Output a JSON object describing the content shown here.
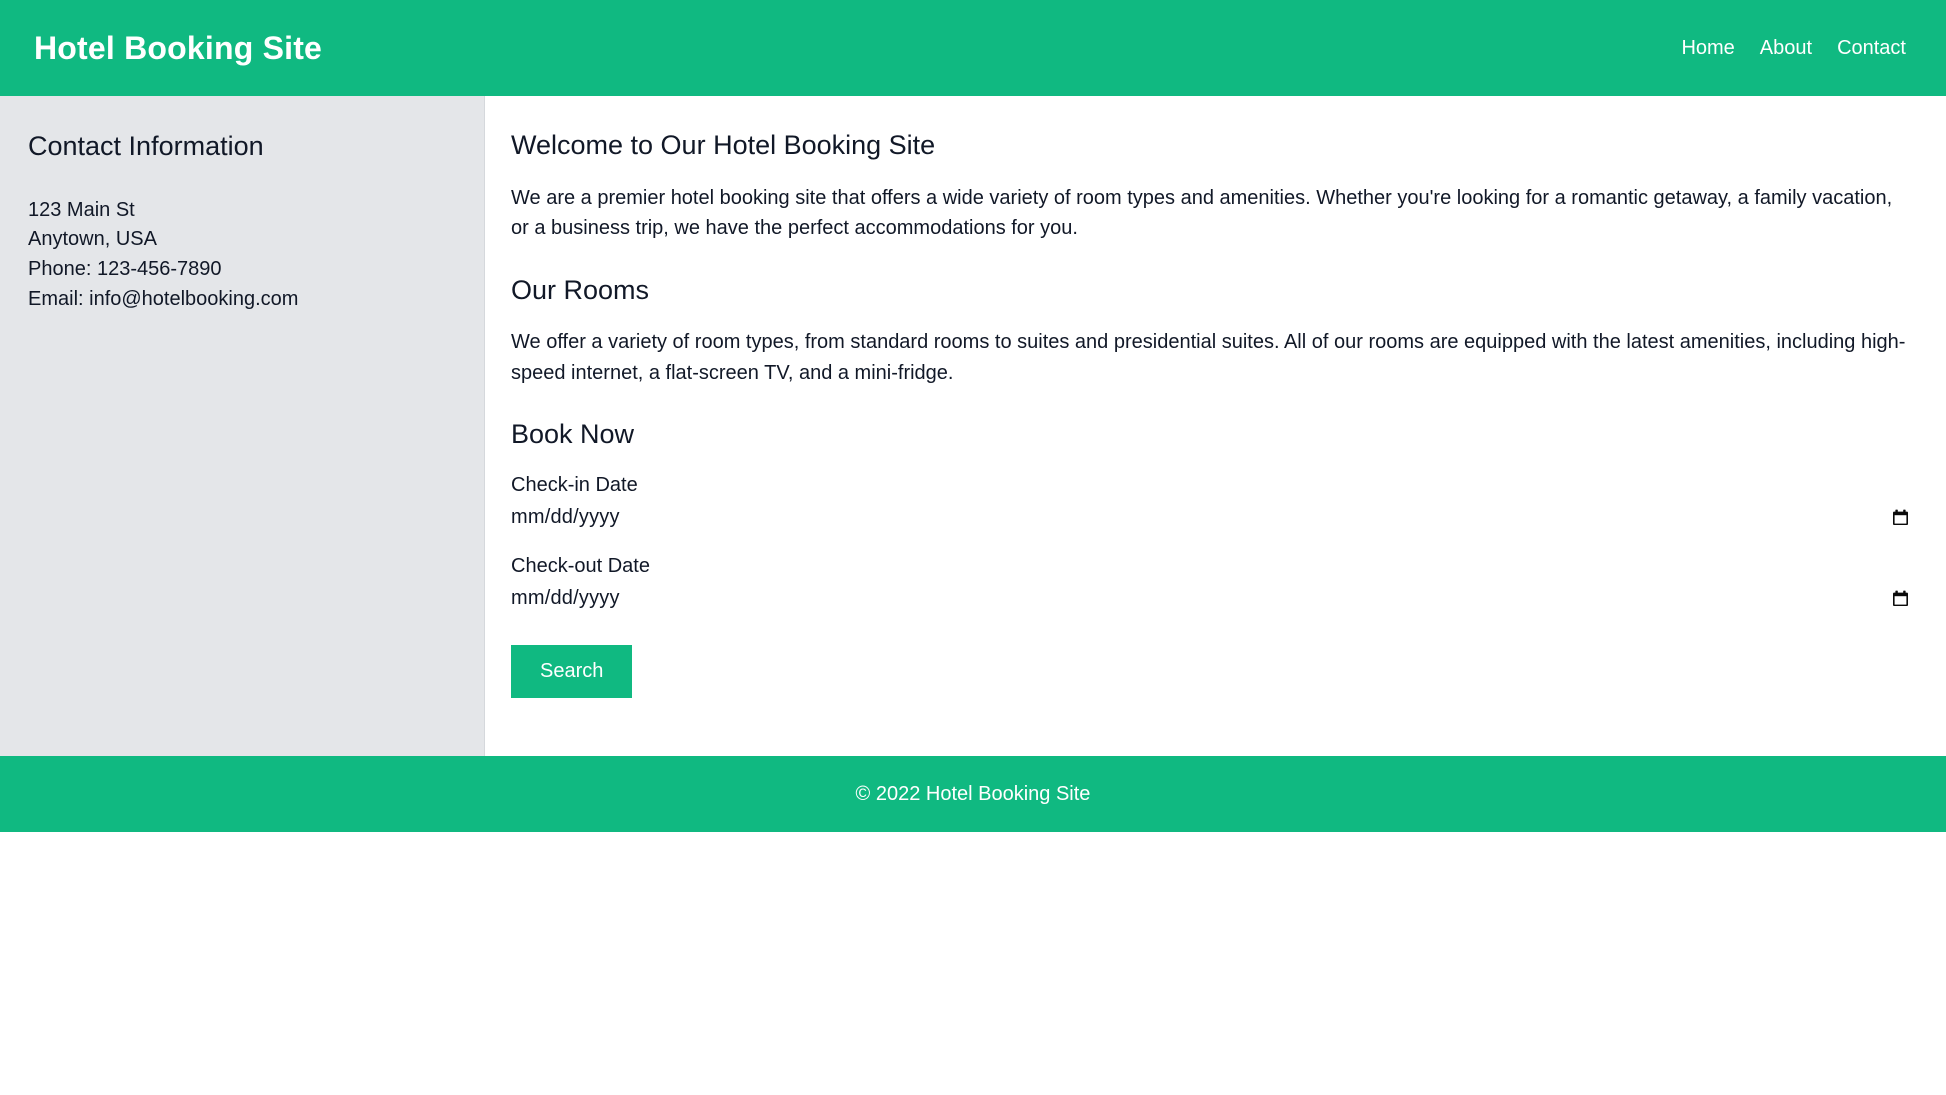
{
  "header": {
    "title": "Hotel Booking Site",
    "brand_color": "#10b981",
    "nav": [
      {
        "label": "Home"
      },
      {
        "label": "About"
      },
      {
        "label": "Contact"
      }
    ]
  },
  "sidebar": {
    "heading": "Contact Information",
    "background_color": "#e4e6e9",
    "contact": {
      "street": "123 Main St",
      "city": "Anytown, USA",
      "phone": "Phone: 123-456-7890",
      "email": "Email: info@hotelbooking.com"
    }
  },
  "main": {
    "welcome": {
      "title": "Welcome to Our Hotel Booking Site",
      "body": "We are a premier hotel booking site that offers a wide variety of room types and amenities. Whether you're looking for a romantic getaway, a family vacation, or a business trip, we have the perfect accommodations for you."
    },
    "rooms": {
      "title": "Our Rooms",
      "body": "We offer a variety of room types, from standard rooms to suites and presidential suites. All of our rooms are equipped with the latest amenities, including high-speed internet, a flat-screen TV, and a mini-fridge."
    },
    "booking": {
      "title": "Book Now",
      "checkin_label": "Check-in Date",
      "checkin_value": "",
      "checkin_placeholder": "mm/dd/yyyy",
      "checkout_label": "Check-out Date",
      "checkout_value": "",
      "checkout_placeholder": "mm/dd/yyyy",
      "search_label": "Search",
      "button_color": "#10b981",
      "date_picker_icon": "calendar-icon"
    }
  },
  "footer": {
    "copyright": "© 2022 Hotel Booking Site",
    "background_color": "#10b981"
  }
}
